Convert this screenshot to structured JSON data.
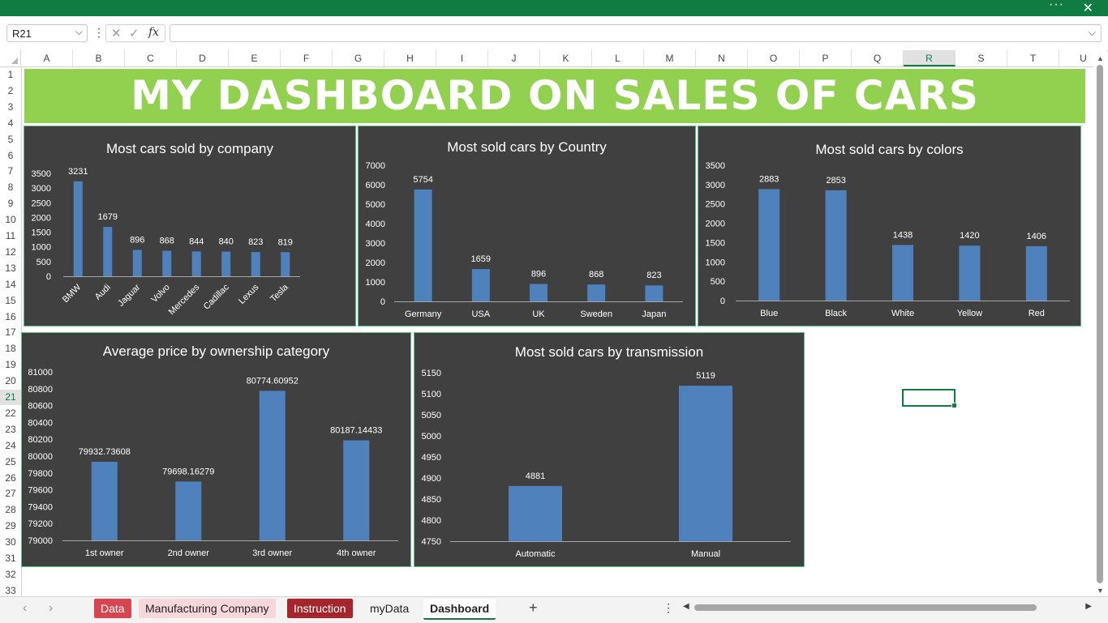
{
  "window": {
    "more_label": "···",
    "close_label": "✕"
  },
  "formula_bar": {
    "name_box": "R21",
    "cancel_icon": "✕",
    "enter_icon": "✓",
    "fx_label": "fx",
    "formula": ""
  },
  "grid": {
    "columns": [
      "A",
      "B",
      "C",
      "D",
      "E",
      "F",
      "G",
      "H",
      "I",
      "J",
      "K",
      "L",
      "M",
      "N",
      "O",
      "P",
      "Q",
      "R",
      "S",
      "T",
      "U"
    ],
    "selected_column": "R",
    "rows": [
      "1",
      "2",
      "3",
      "4",
      "5",
      "6",
      "7",
      "8",
      "9",
      "10",
      "11",
      "12",
      "13",
      "14",
      "15",
      "16",
      "17",
      "18",
      "19",
      "20",
      "21",
      "22",
      "23",
      "24",
      "25",
      "26",
      "27",
      "28",
      "29",
      "30",
      "31",
      "32",
      "33"
    ],
    "selected_row": "21"
  },
  "banner": {
    "title": "MY DASHBOARD ON SALES OF CARS"
  },
  "colors": {
    "accent": "#107c41",
    "banner": "#92d050",
    "chart_bg": "#404040",
    "bar": "#4f81bd",
    "chart_border": "#57c289"
  },
  "chart_data": [
    {
      "type": "bar",
      "title": "Most cars sold by company",
      "categories": [
        "BMW",
        "Audi",
        "Jaguar",
        "Volvo",
        "Mercedes",
        "Cadillac",
        "Lexus",
        "Tesla"
      ],
      "values": [
        3231,
        1679,
        896,
        868,
        844,
        840,
        823,
        819
      ],
      "ylim": [
        0,
        3500
      ],
      "yticks": [
        "0",
        "500",
        "1000",
        "1500",
        "2000",
        "2500",
        "3000",
        "3500"
      ],
      "grid": false
    },
    {
      "type": "bar",
      "title": "Most sold cars by Country",
      "categories": [
        "Germany",
        "USA",
        "UK",
        "Sweden",
        "Japan"
      ],
      "values": [
        5754,
        1659,
        896,
        868,
        823
      ],
      "ylim": [
        0,
        7000
      ],
      "yticks": [
        "0",
        "1000",
        "2000",
        "3000",
        "4000",
        "5000",
        "6000",
        "7000"
      ],
      "grid": false
    },
    {
      "type": "bar",
      "title": "Most sold cars by colors",
      "categories": [
        "Blue",
        "Black",
        "White",
        "Yellow",
        "Red"
      ],
      "values": [
        2883,
        2853,
        1438,
        1420,
        1406
      ],
      "ylim": [
        0,
        3500
      ],
      "yticks": [
        "0",
        "500",
        "1000",
        "1500",
        "2000",
        "2500",
        "3000",
        "3500"
      ],
      "grid": false
    },
    {
      "type": "bar",
      "title": "Average price by ownership category",
      "categories": [
        "1st owner",
        "2nd owner",
        "3rd owner",
        "4th owner"
      ],
      "values": [
        79932.73608,
        79698.16279,
        80774.60952,
        80187.14433
      ],
      "data_labels": [
        "79932.73608",
        "79698.16279",
        "80774.60952",
        "80187.14433"
      ],
      "ylim": [
        79000,
        81000
      ],
      "yticks": [
        "79000",
        "79200",
        "79400",
        "79600",
        "79800",
        "80000",
        "80200",
        "80400",
        "80600",
        "80800",
        "81000"
      ],
      "grid": false
    },
    {
      "type": "bar",
      "title": "Most sold cars by transmission",
      "categories": [
        "Automatic",
        "Manual"
      ],
      "values": [
        4881,
        5119
      ],
      "ylim": [
        4750,
        5150
      ],
      "yticks": [
        "4750",
        "4800",
        "4850",
        "4900",
        "4950",
        "5000",
        "5050",
        "5100",
        "5150"
      ],
      "grid": false
    }
  ],
  "sheet_tabs": [
    {
      "label": "Data",
      "color": "#d64550",
      "text_color": "#ffffff"
    },
    {
      "label": "Manufacturing Company",
      "color": "#f8d7da",
      "text_color": "#222222"
    },
    {
      "label": "Instruction",
      "color": "#a4262c",
      "text_color": "#ffffff"
    },
    {
      "label": "myData",
      "color": "",
      "text_color": "#222222"
    },
    {
      "label": "Dashboard",
      "color": "#ffffff",
      "text_color": "#222222",
      "active": true
    }
  ],
  "icons": {
    "prev_sheet": "chevron-left-icon",
    "next_sheet": "chevron-right-icon",
    "add_sheet": "plus-icon"
  }
}
